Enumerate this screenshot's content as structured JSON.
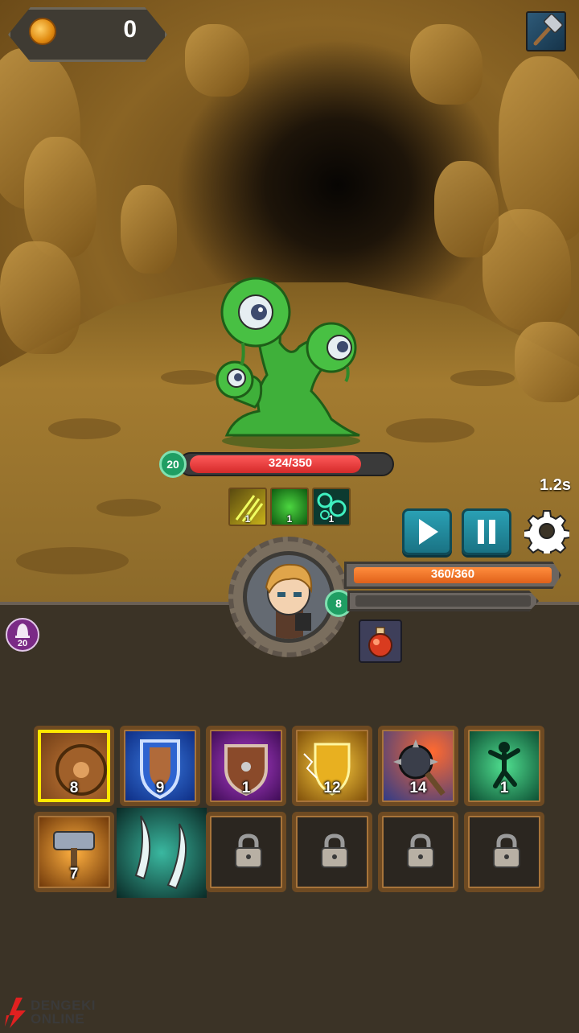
{
  "hud": {
    "coins": "0",
    "speed": "1.2s",
    "icons": {
      "coin": "coin-icon",
      "weapon": "hammer-icon",
      "play": "play-icon",
      "pause": "pause-icon",
      "settings": "gear-icon"
    }
  },
  "enemy": {
    "name_icon": "green-slime-monster",
    "level": "20",
    "hp_text": "324/350",
    "hp_fraction": 0.926,
    "status_effects": [
      {
        "icon": "claw-slash-icon",
        "count": "1"
      },
      {
        "icon": "poison-cloud-icon",
        "count": "1"
      },
      {
        "icon": "bubbles-icon",
        "count": "1"
      }
    ]
  },
  "hero": {
    "level": "8",
    "hp_text": "360/360",
    "hp_fraction": 1.0,
    "xp_fraction": 0.0,
    "bell_count": "20",
    "potion_icon": "red-potion-icon"
  },
  "skills": [
    {
      "icon": "round-shield-icon",
      "count": "8",
      "selected": true
    },
    {
      "icon": "blue-shield-icon",
      "count": "9"
    },
    {
      "icon": "wooden-shield-icon",
      "count": "1"
    },
    {
      "icon": "lightning-shield-icon",
      "count": "12"
    },
    {
      "icon": "spiked-mace-icon",
      "count": "14"
    },
    {
      "icon": "leaping-figure-icon",
      "count": "1"
    },
    {
      "icon": "war-hammer-icon",
      "count": "7"
    },
    {
      "icon": "twin-daggers-icon",
      "count": ""
    },
    {
      "icon": "lock-icon",
      "count": ""
    },
    {
      "icon": "lock-icon",
      "count": ""
    },
    {
      "icon": "lock-icon",
      "count": ""
    },
    {
      "icon": "lock-icon",
      "count": ""
    }
  ],
  "watermark": {
    "line1": "DENGEKI",
    "line2": "ONLINE",
    "colors": {
      "bolt": "#e02020",
      "text": "#3a3a3a"
    }
  },
  "colors": {
    "enemy_hp": "#d42a2a",
    "hero_hp": "#e0611a",
    "level_badge": "#1f9e63",
    "button": "#1a7384"
  }
}
